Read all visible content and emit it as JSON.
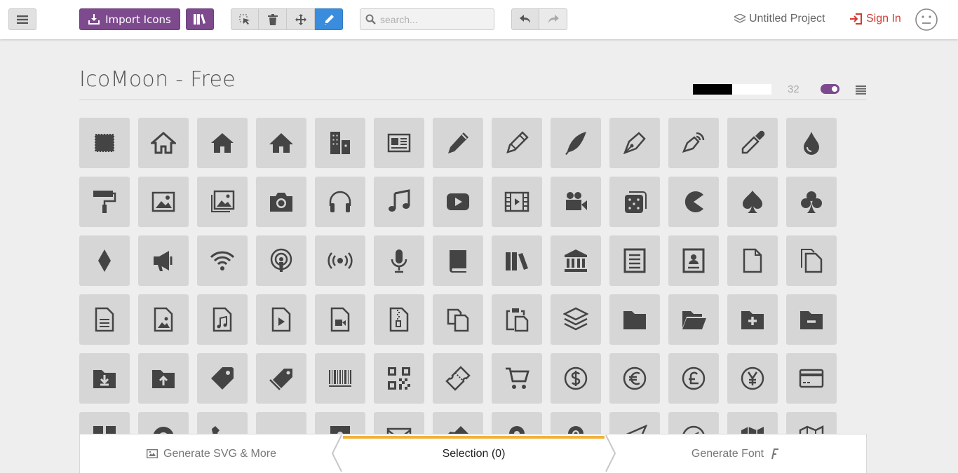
{
  "toolbar": {
    "import_label": "Import Icons",
    "search_placeholder": "search...",
    "project_label": "Untitled Project",
    "signin_label": "Sign In"
  },
  "icon_set": {
    "title": "IcoMoon - Free",
    "size": "32",
    "icons": [
      "stamp-icon",
      "home-icon",
      "home2-icon",
      "home3-icon",
      "office-icon",
      "newspaper-icon",
      "pencil-icon",
      "pencil2-icon",
      "quill-icon",
      "pen-icon",
      "blog-icon",
      "eyedropper-icon",
      "droplet-icon",
      "paint-roller-icon",
      "image-icon",
      "images-icon",
      "camera-icon",
      "headphones-icon",
      "music-icon",
      "play-icon",
      "film-icon",
      "video-camera-icon",
      "dice-icon",
      "pacman-icon",
      "spades-icon",
      "clubs-icon",
      "diamonds-icon",
      "bullhorn-icon",
      "wifi-icon",
      "podcast-icon",
      "radio-feed-icon",
      "mic-icon",
      "book-icon",
      "books-icon",
      "library-icon",
      "file-text-icon",
      "profile-icon",
      "file-empty-icon",
      "files-empty-icon",
      "file-text2-icon",
      "file-picture-icon",
      "file-music-icon",
      "file-play-icon",
      "file-video-icon",
      "file-zip-icon",
      "copy-icon",
      "paste-icon",
      "stack-icon",
      "folder-icon",
      "folder-open-icon",
      "folder-plus-icon",
      "folder-minus-icon",
      "folder-download-icon",
      "folder-upload-icon",
      "price-tag-icon",
      "price-tags-icon",
      "barcode-icon",
      "qrcode-icon",
      "ticket-icon",
      "cart-icon",
      "coin-dollar-icon",
      "coin-euro-icon",
      "coin-pound-icon",
      "coin-yen-icon",
      "credit-card-icon",
      "calculator-icon",
      "lifebuoy-icon",
      "phone-icon",
      "phone-hang-up-icon",
      "address-book-icon",
      "envelop-icon",
      "pushpin-icon",
      "location-icon",
      "location2-icon",
      "compass-icon",
      "compass2-icon",
      "map-icon",
      "map2-icon"
    ]
  },
  "footer": {
    "generate_svg_label": "Generate SVG & More",
    "selection_label": "Selection (0)",
    "generate_font_label": "Generate Font"
  }
}
